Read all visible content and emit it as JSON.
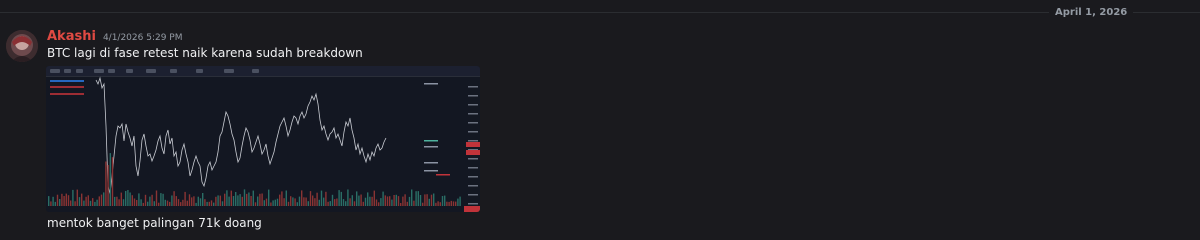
{
  "divider": {
    "date": "April 1, 2026"
  },
  "message": {
    "author": "Akashi",
    "author_color": "#e04a43",
    "timestamp": "4/1/2026 5:29 PM",
    "text": "BTC lagi di fase retest naik karena sudah breakdown",
    "attachment": {
      "kind": "chart-screenshot"
    },
    "followup_text": "mentok banget palingan 71k doang"
  },
  "colors": {
    "background": "#1a1a1e",
    "chart_background": "#131722",
    "price_line": "#c9ccd3",
    "volume_up": "#2a6e66",
    "volume_down": "#8a3434"
  }
}
